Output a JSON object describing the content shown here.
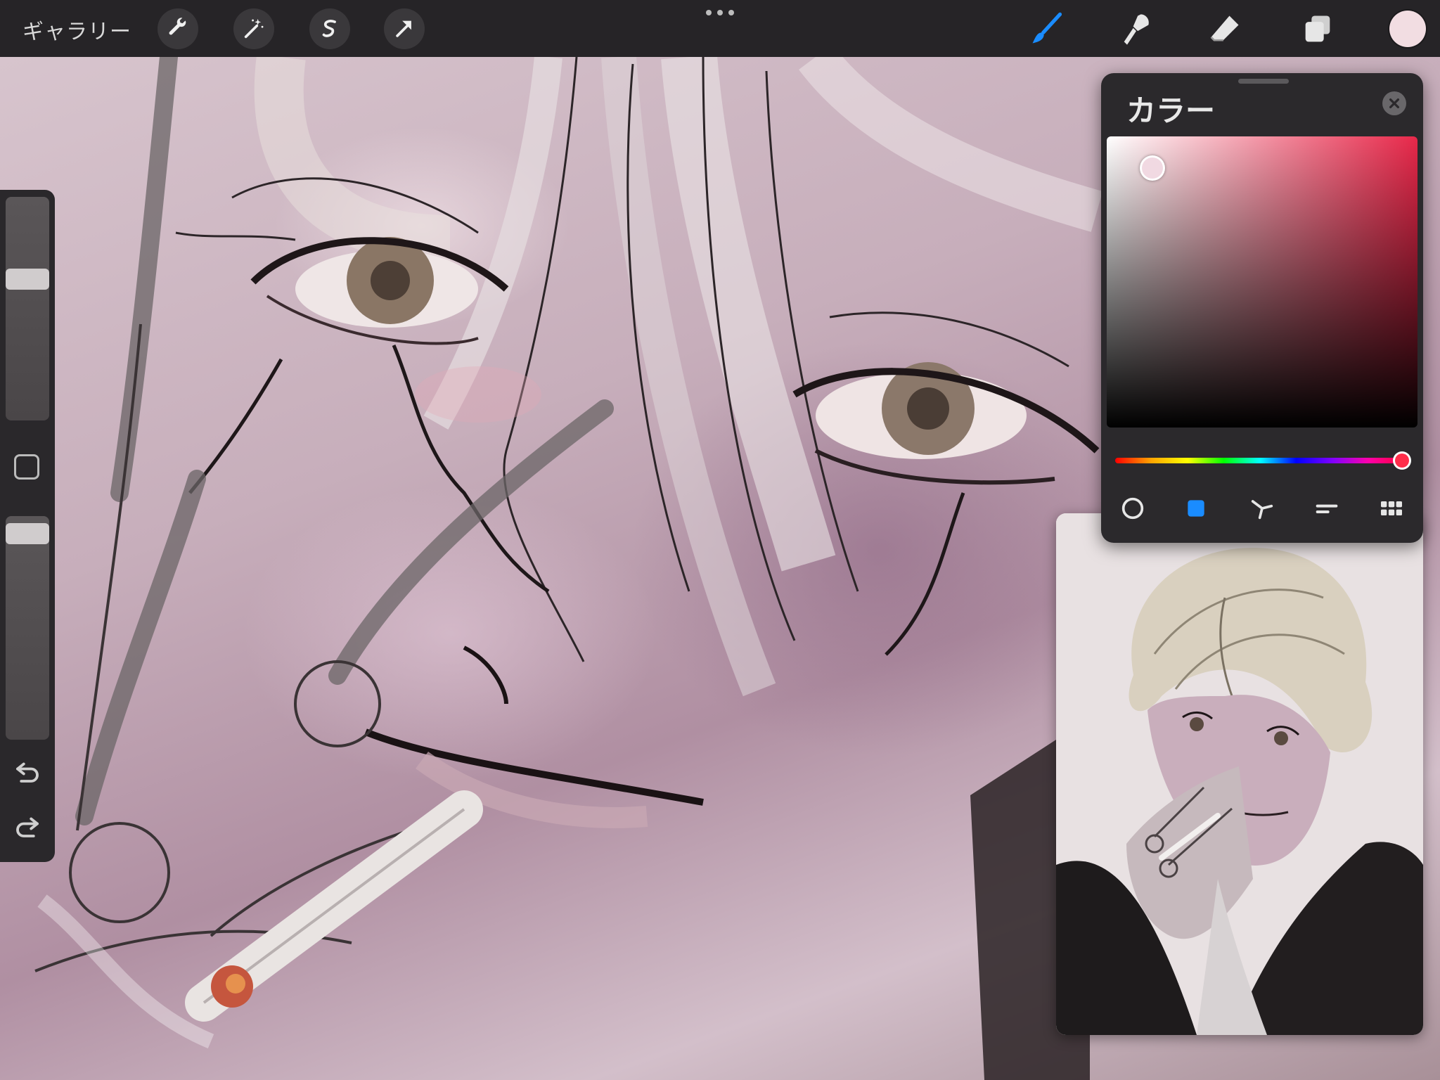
{
  "toolbar": {
    "gallery_label": "ギャラリー",
    "actions": [
      {
        "name": "actions-button",
        "icon": "wrench-icon"
      },
      {
        "name": "adjustments-button",
        "icon": "magic-wand-icon"
      },
      {
        "name": "selection-button",
        "icon": "selection-s-icon"
      },
      {
        "name": "transform-button",
        "icon": "arrow-cursor-icon"
      }
    ],
    "more_icon": "more-dots-icon",
    "tools": [
      {
        "name": "brush-tool",
        "icon": "brush-icon",
        "active": true
      },
      {
        "name": "smudge-tool",
        "icon": "smudge-icon",
        "active": false
      },
      {
        "name": "eraser-tool",
        "icon": "eraser-icon",
        "active": false
      },
      {
        "name": "layers-button",
        "icon": "layers-icon",
        "active": false
      }
    ],
    "current_color": "#f2dde2",
    "active_tool_color": "#1a8cff"
  },
  "sidebar": {
    "size_slider_level": 0.65,
    "opacity_slider_level": 0.95,
    "modify_icon": "square-icon",
    "undo_icon": "undo-icon",
    "redo_icon": "redo-icon"
  },
  "color_panel": {
    "title": "カラー",
    "close_icon": "close-icon",
    "hue_color": "#e8284a",
    "selected_color": "#f1d9e2",
    "modes": [
      {
        "name": "disc-mode",
        "icon": "disc-icon",
        "active": false
      },
      {
        "name": "classic-mode",
        "icon": "classic-square-icon",
        "active": true
      },
      {
        "name": "harmony-mode",
        "icon": "harmony-icon",
        "active": false
      },
      {
        "name": "value-mode",
        "icon": "value-sliders-icon",
        "active": false
      },
      {
        "name": "palettes-mode",
        "icon": "palette-grid-icon",
        "active": false
      }
    ]
  },
  "reference": {
    "content": "reference-image"
  }
}
